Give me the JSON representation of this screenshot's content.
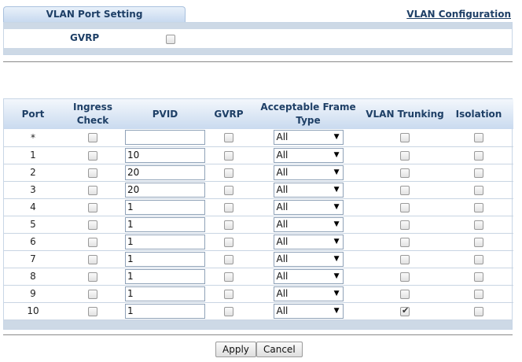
{
  "tab": {
    "label": "VLAN Port Setting"
  },
  "link": {
    "label": "VLAN Configuration"
  },
  "gvrp": {
    "label": "GVRP",
    "checked": false
  },
  "table": {
    "headers": {
      "port": "Port",
      "ingress_line1": "Ingress",
      "ingress_line2": "Check",
      "pvid": "PVID",
      "gvrp": "GVRP",
      "frame_type": "Acceptable Frame Type",
      "trunking": "VLAN Trunking",
      "isolation": "Isolation"
    },
    "rows": [
      {
        "port": "*",
        "pvid": "",
        "frame": "All",
        "ingress": false,
        "gvrp": false,
        "trunking": false,
        "isolation": false
      },
      {
        "port": "1",
        "pvid": "10",
        "frame": "All",
        "ingress": false,
        "gvrp": false,
        "trunking": false,
        "isolation": false
      },
      {
        "port": "2",
        "pvid": "20",
        "frame": "All",
        "ingress": false,
        "gvrp": false,
        "trunking": false,
        "isolation": false
      },
      {
        "port": "3",
        "pvid": "20",
        "frame": "All",
        "ingress": false,
        "gvrp": false,
        "trunking": false,
        "isolation": false
      },
      {
        "port": "4",
        "pvid": "1",
        "frame": "All",
        "ingress": false,
        "gvrp": false,
        "trunking": false,
        "isolation": false
      },
      {
        "port": "5",
        "pvid": "1",
        "frame": "All",
        "ingress": false,
        "gvrp": false,
        "trunking": false,
        "isolation": false
      },
      {
        "port": "6",
        "pvid": "1",
        "frame": "All",
        "ingress": false,
        "gvrp": false,
        "trunking": false,
        "isolation": false
      },
      {
        "port": "7",
        "pvid": "1",
        "frame": "All",
        "ingress": false,
        "gvrp": false,
        "trunking": false,
        "isolation": false
      },
      {
        "port": "8",
        "pvid": "1",
        "frame": "All",
        "ingress": false,
        "gvrp": false,
        "trunking": false,
        "isolation": false
      },
      {
        "port": "9",
        "pvid": "1",
        "frame": "All",
        "ingress": false,
        "gvrp": false,
        "trunking": false,
        "isolation": false
      },
      {
        "port": "10",
        "pvid": "1",
        "frame": "All",
        "ingress": false,
        "gvrp": false,
        "trunking": true,
        "isolation": false
      }
    ]
  },
  "buttons": {
    "apply": "Apply",
    "cancel": "Cancel"
  }
}
